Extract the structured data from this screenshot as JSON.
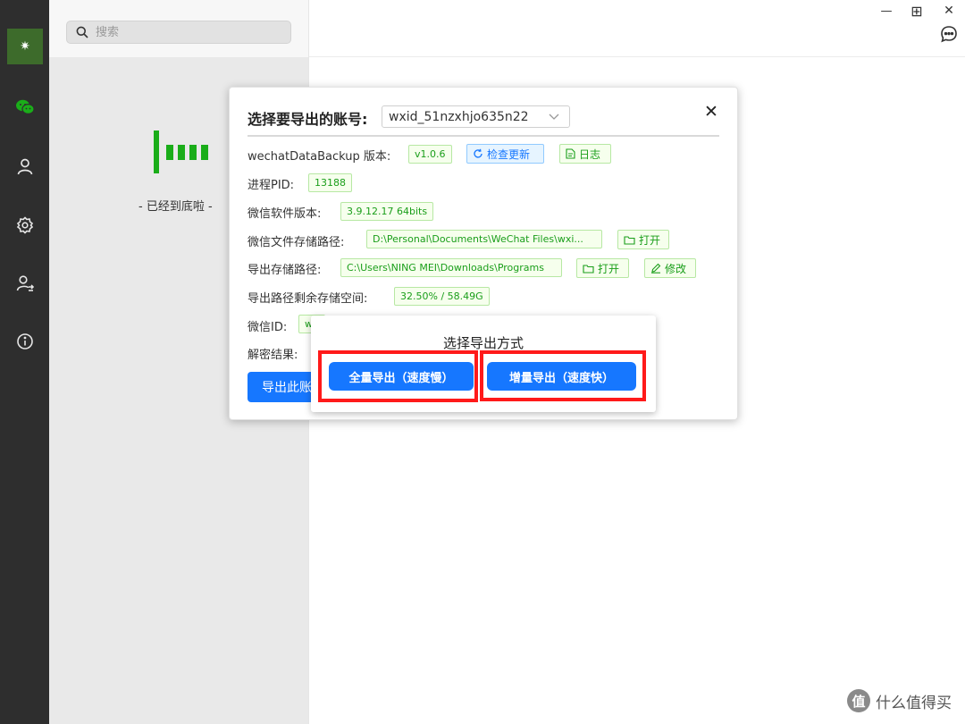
{
  "sidebar": {
    "logo_glyph": "✷",
    "items": [
      {
        "name": "wechat-icon"
      },
      {
        "name": "user-icon"
      },
      {
        "name": "gear-icon"
      },
      {
        "name": "user-switch-icon"
      },
      {
        "name": "info-icon"
      }
    ]
  },
  "list": {
    "search_placeholder": "搜索",
    "end_text": "- 已经到底啦 -"
  },
  "window": {
    "minimize": "—",
    "maximize": "⊞",
    "close": "✕"
  },
  "dialog": {
    "title": "选择要导出的账号:",
    "account_selected": "wxid_51nzxhjo635n22",
    "close": "✕",
    "rows": {
      "version_label": "wechatDataBackup 版本:",
      "version_value": "v1.0.6",
      "check_update": "检查更新",
      "log": "日志",
      "pid_label": "进程PID:",
      "pid_value": "13188",
      "wechat_version_label": "微信软件版本:",
      "wechat_version_value": "3.9.12.17 64bits",
      "file_path_label": "微信文件存储路径:",
      "file_path_value": "D:\\Personal\\Documents\\WeChat Files\\wxi...",
      "open_label": "打开",
      "export_path_label": "导出存储路径:",
      "export_path_value": "C:\\Users\\NING MEI\\Downloads\\Programs",
      "modify_label": "修改",
      "space_label": "导出路径剩余存储空间:",
      "space_value": "32.50% / 58.49G",
      "wechat_id_label": "微信ID:",
      "wechat_id_value": "w",
      "decrypt_label": "解密结果:"
    },
    "export_button": "导出此账号"
  },
  "popover": {
    "title": "选择导出方式",
    "full_export": "全量导出（速度慢）",
    "incremental_export": "增量导出（速度快）"
  },
  "colors": {
    "accent": "#1677ff",
    "brand_green": "#1aad19",
    "highlight": "#ff1a1a"
  },
  "watermark": {
    "glyph": "值",
    "text": "什么值得买"
  }
}
